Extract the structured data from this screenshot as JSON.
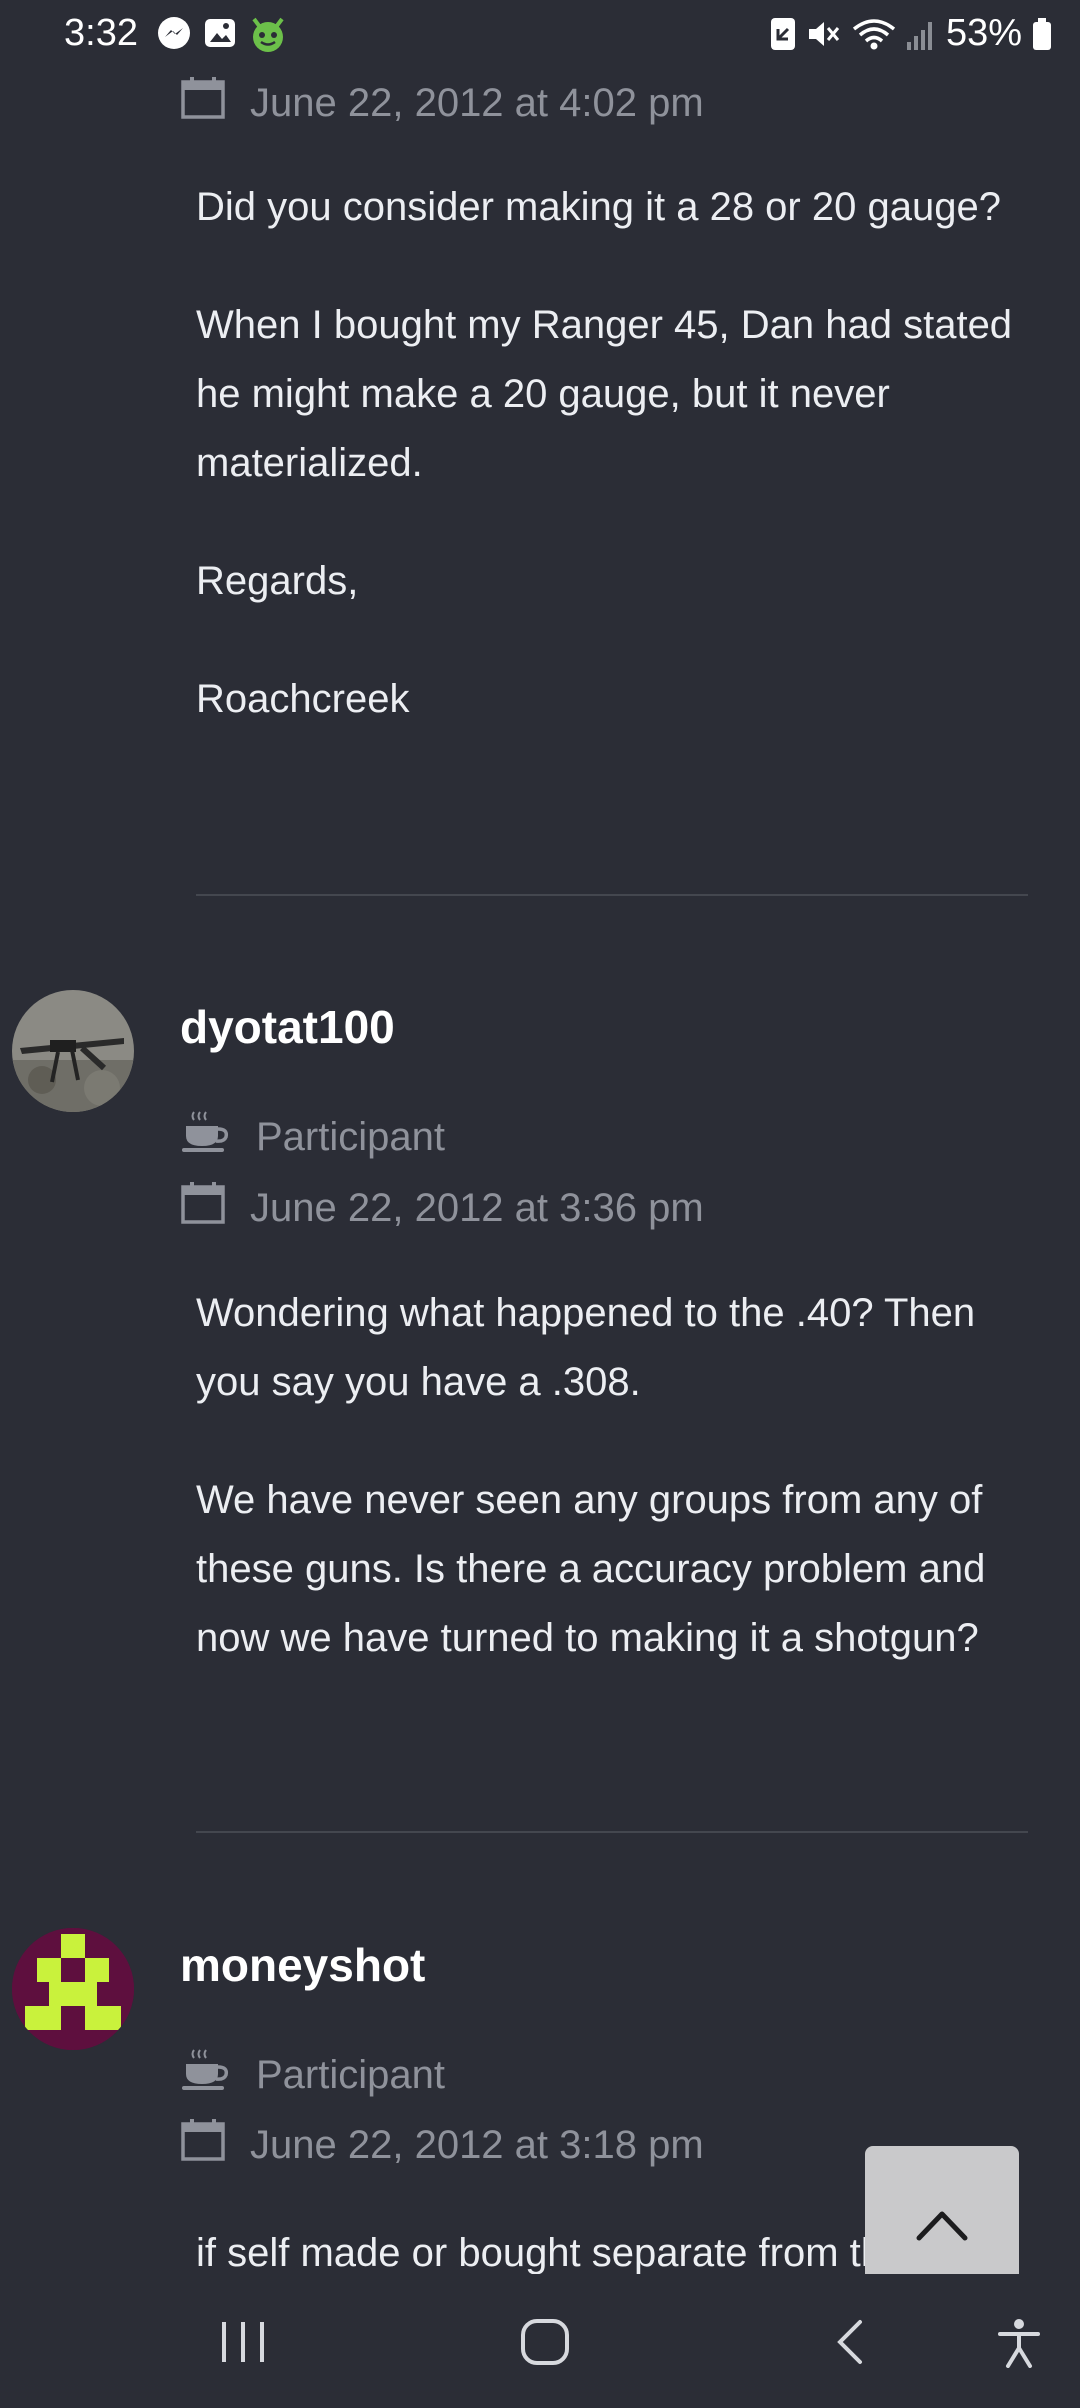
{
  "status_bar": {
    "time": "3:32",
    "notification_icons": [
      "messenger-icon",
      "gallery-icon",
      "android-devil-icon"
    ],
    "system_icons": [
      "nfc-icon",
      "mute-icon",
      "wifi-icon",
      "signal-icon",
      "battery-icon"
    ],
    "battery": "53%"
  },
  "posts": [
    {
      "date": "June 22, 2012 at 4:02 pm",
      "paragraphs": [
        "Did you consider making it a 28 or 20 gauge?",
        "When I bought my Ranger 45, Dan had stated he might make a 20 gauge, but it never materialized.",
        "Regards,",
        "Roachcreek"
      ]
    },
    {
      "author": "dyotat100",
      "role": "Participant",
      "date": "June 22, 2012 at 3:36 pm",
      "paragraphs": [
        "Wondering what happened to the .40? Then you say you have a .308.",
        "We have never seen any groups from any of these guns. Is there a accuracy problem and now we have turned to making it a shotgun?"
      ]
    },
    {
      "author": "moneyshot",
      "role": "Participant",
      "date": "June 22, 2012 at 3:18 pm",
      "paragraphs": [
        "if self made or bought separate from the"
      ]
    }
  ],
  "colors": {
    "background": "#2b2d36",
    "text": "#eceef2",
    "meta": "#8f929b",
    "divider": "#44474f",
    "avatar_moneyshot_bg": "#5e0f3e",
    "avatar_moneyshot_fg": "#c9f23c"
  },
  "nav_bar": {
    "buttons": [
      "recents-icon",
      "home-icon",
      "back-icon",
      "accessibility-icon"
    ]
  }
}
